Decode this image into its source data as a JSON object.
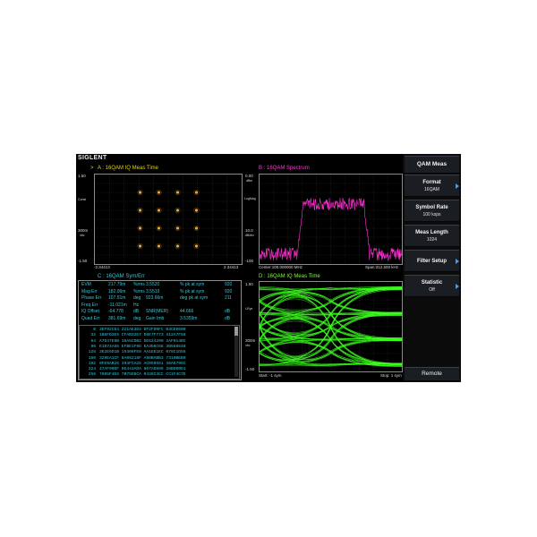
{
  "app": {
    "brand": "SIGLENT"
  },
  "pane_a": {
    "marker": ">",
    "title": "A : 16QAM  IQ Meas Time",
    "y_top": "1.50",
    "y_mid_label": "Const",
    "y_lower": "300m",
    "y_lower_unit": "/div",
    "y_bottom": "-1.50",
    "x_left": "-2.34413",
    "x_right": "2.34413"
  },
  "pane_b": {
    "title": "B : 16QAM  Spectrum",
    "y_top": "0.00",
    "y_top_unit": "dBm",
    "y_scale": "LogMag",
    "y_lower": "10.0",
    "y_lower_unit": "dB/div",
    "y_bottom": "-100",
    "x_left": "Center:100.000000 MHz",
    "x_right": "Span:312.500 kHz"
  },
  "pane_c": {
    "title": "C : 16QAM  Sym/Err",
    "rows": [
      [
        "EVM",
        "217.79m",
        "%rms",
        "3.5520",
        "% pk at sym",
        "920"
      ],
      [
        "Mag Err",
        "182.06m",
        "%rms",
        "3.5519",
        "% pk at sym",
        "920"
      ],
      [
        "Phase Err",
        "107.51m",
        "deg",
        "923.66m",
        "deg pk at sym",
        "211"
      ],
      [
        "Freq Err",
        "-11.021m",
        "Hz",
        "",
        "",
        ""
      ],
      [
        "IQ Offset",
        "-64.778",
        "dB",
        "SNR(MER)",
        "44.666",
        "dB"
      ],
      [
        "Quad Err",
        "381.69m",
        "deg",
        "Gain Imb",
        "3.5359m",
        "dB"
      ]
    ],
    "symbols": [
      {
        "idx": "0",
        "vals": "3EF92C64  221AE3D4  DF2FD0FC  B3CE0600"
      },
      {
        "idx": "32",
        "vals": "1B6FD2E5  CFAB32E7  D6E7F773  312A7F56"
      },
      {
        "idx": "64",
        "vals": "A7D47E8B  16A5CDB2  DE624200  3AF014BC"
      },
      {
        "idx": "96",
        "vals": "E1D74A55  EFBE1F6D  EA3D6C66  3B568640"
      },
      {
        "idx": "128",
        "vals": "3E2E6D1B  15308FE0  AA1EE1EC  078C1D55"
      },
      {
        "idx": "160",
        "vals": "329EA1CF  8A06218F  A98BABB3  7310BEB9"
      },
      {
        "idx": "192",
        "vals": "0FE9AB26  394FCA25  AC059551  30A6796C"
      },
      {
        "idx": "224",
        "vals": "47AF90DF  0E443ADA  807AD899  36BD00D1"
      },
      {
        "idx": "256",
        "vals": "7085F4E6  7B75D8CA  0438C3CC  CC1F4C7E"
      }
    ]
  },
  "pane_d": {
    "title": "D : 16QAM  IQ Meas Time",
    "y_top": "1.50",
    "y_scale": "I-Eye",
    "y_lower": "300m",
    "y_lower_unit": "/div",
    "y_bottom": "-1.50",
    "x_left": "Start: -1 sym",
    "x_right": "Stop: 1 sym"
  },
  "menu": {
    "title": "QAM Meas",
    "items": [
      {
        "label": "Format",
        "value": "16QAM",
        "arrow": true
      },
      {
        "label": "Symbol Rate",
        "value": "100 ksps",
        "arrow": false
      },
      {
        "label": "Meas Length",
        "value": "1024",
        "arrow": false
      },
      {
        "label": "Filter Setup",
        "value": "",
        "arrow": true
      },
      {
        "label": "Statistic",
        "value": "Off",
        "arrow": true
      }
    ],
    "remote": "Remote"
  },
  "colors": {
    "constellation": "#e8a43a",
    "spectrum": "#ff2fd2",
    "eye": "#3cff1e",
    "table_text": "#35c6d6",
    "menu_arrow": "#3aa0ff"
  }
}
